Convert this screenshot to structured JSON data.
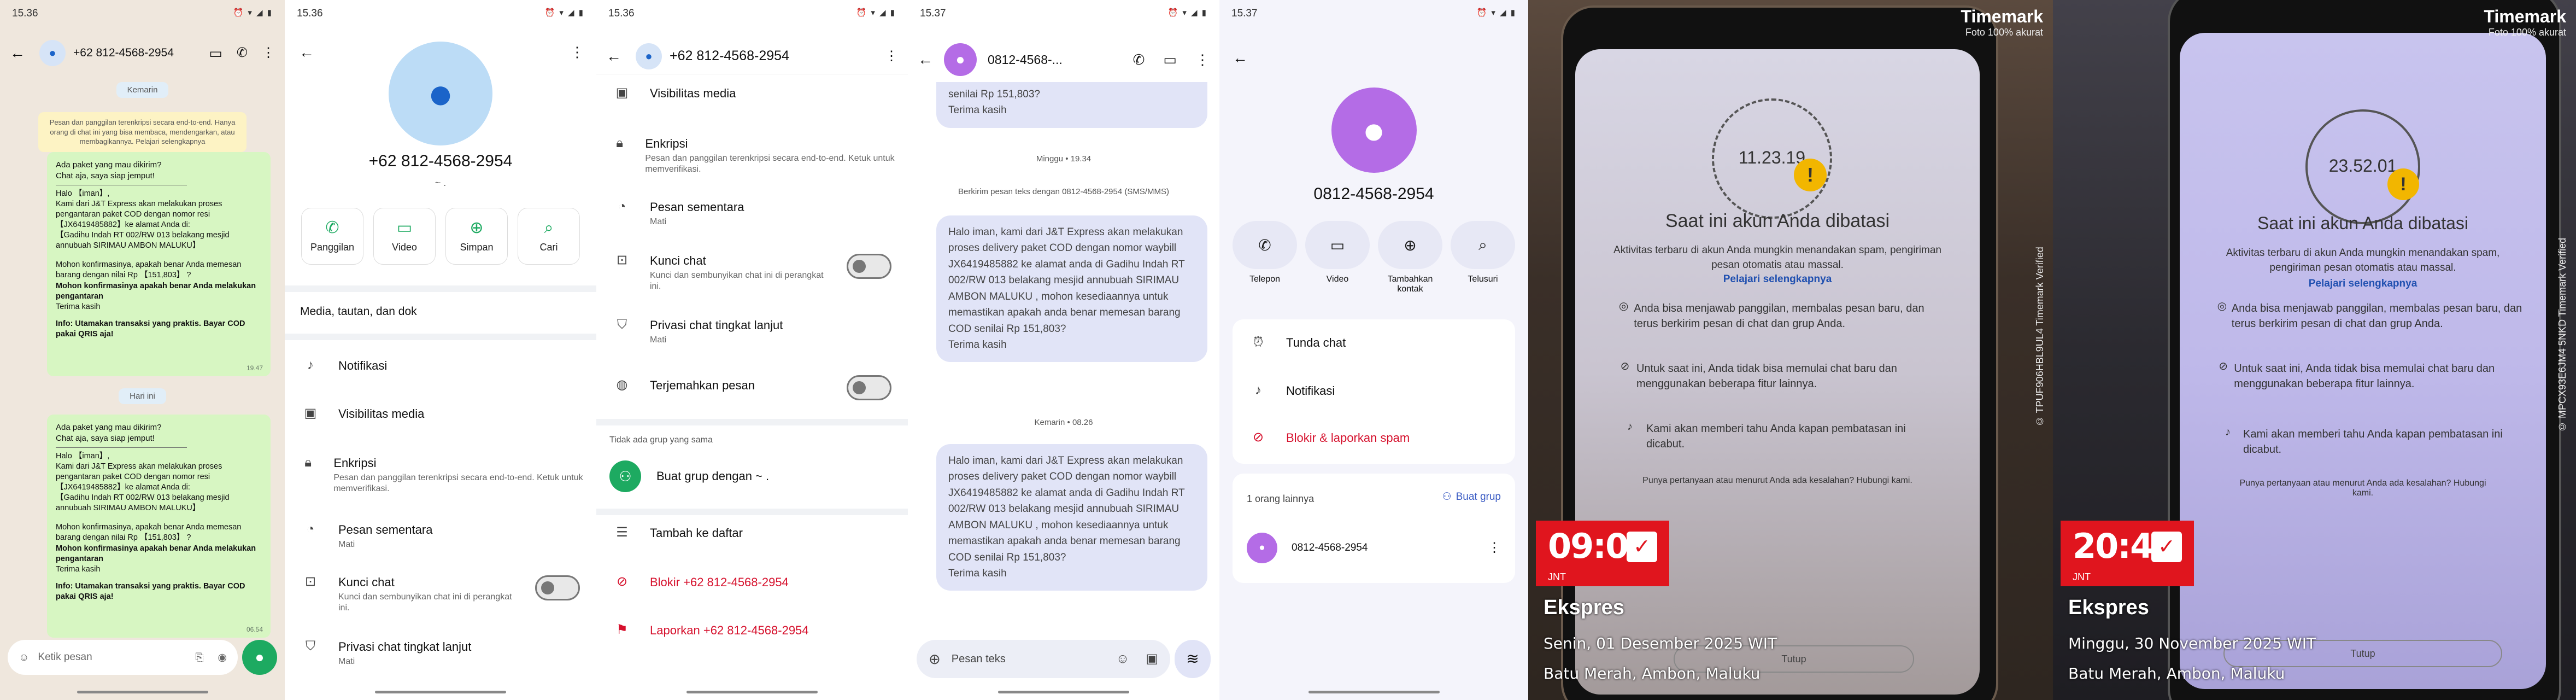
{
  "p1": {
    "time": "15.36",
    "title": "+62 812-4568-2954",
    "day1": "Kemarin",
    "day2": "Hari ini",
    "encryption": "Pesan dan panggilan terenkripsi secara end-to-end. Hanya orang di chat ini yang bisa membaca, mendengarkan, atau membagikannya. Pelajari selengkapnya",
    "m1_top": "Ada paket yang mau dikirim?\nChat aja, saya siap jemput!",
    "m1_body": "Halo 【iman】,\nKami dari J&T Express akan melakukan proses pengantaran paket COD dengan nomor resi 【JX6419485882】ke alamat Anda di:\n【Gadihu Indah RT 002/RW 013 belakang mesjid annubuah SIRIMAU AMBON MALUKU】",
    "m1_confirm": "Mohon konfirmasinya, apakah benar Anda memesan barang dengan nilai Rp 【151,803】 ?",
    "m1_bold": "Mohon konfirmasinya apakah benar Anda melakukan pengantaran",
    "m1_thanks": "Terima kasih",
    "m1_info": "Info: Utamakan transaksi yang praktis. Bayar COD pakai QRIS aja!",
    "m1_time": "19.47",
    "m2_time": "06.54",
    "compose": "Ketik pesan"
  },
  "p2": {
    "time": "15.36",
    "name": "+62 812-4568-2954",
    "about": "~ .",
    "actions": [
      "Panggilan",
      "Video",
      "Simpan",
      "Cari"
    ],
    "media": "Media, tautan, dan dok",
    "rows": [
      {
        "label": "Notifikasi"
      },
      {
        "label": "Visibilitas media"
      },
      {
        "label": "Enkripsi",
        "sub": "Pesan dan panggilan terenkripsi secara end-to-end. Ketuk untuk memverifikasi."
      },
      {
        "label": "Pesan sementara",
        "sub": "Mati"
      },
      {
        "label": "Kunci chat",
        "sub": "Kunci dan sembunyikan chat ini di perangkat ini."
      },
      {
        "label": "Privasi chat tingkat lanjut",
        "sub": "Mati"
      }
    ]
  },
  "p3": {
    "time": "15.36",
    "title": "+62 812-4568-2954",
    "rows": [
      {
        "label": "Visibilitas media"
      },
      {
        "label": "Enkripsi",
        "sub": "Pesan dan panggilan terenkripsi secara end-to-end. Ketuk untuk memverifikasi."
      },
      {
        "label": "Pesan sementara",
        "sub": "Mati"
      },
      {
        "label": "Kunci chat",
        "sub": "Kunci dan sembunyikan chat ini di perangkat ini."
      },
      {
        "label": "Privasi chat tingkat lanjut",
        "sub": "Mati"
      },
      {
        "label": "Terjemahkan pesan"
      }
    ],
    "nogroup": "Tidak ada grup yang sama",
    "create": "Buat grup dengan ~ .",
    "add": "Tambah ke daftar",
    "block": "Blokir +62 812-4568-2954",
    "report": "Laporkan +62 812-4568-2954"
  },
  "p4": {
    "time": "15.37",
    "title": "0812-4568-...",
    "top_tail": "senilai Rp 151,803?\nTerima kasih",
    "meta1": "Minggu • 19.34",
    "meta2": "Berkirim pesan teks dengan 0812-4568-2954 (SMS/MMS)",
    "meta3": "Kemarin • 08.26",
    "msg": "Halo iman, kami dari J&T Express akan melakukan proses delivery paket COD dengan nomor waybill JX6419485882 ke alamat anda di Gadihu Indah RT 002/RW 013 belakang mesjid annubuah  SIRIMAU AMBON MALUKU , mohon kesediaannya untuk memastikan apakah anda benar memesan barang COD senilai Rp 151,803?\nTerima kasih",
    "compose": "Pesan teks"
  },
  "p5": {
    "time": "15.37",
    "name": "0812-4568-2954",
    "actions": [
      "Telepon",
      "Video",
      "Tambahkan kontak",
      "Telusuri"
    ],
    "opts": [
      "Tunda chat",
      "Notifikasi",
      "Blokir & laporkan spam"
    ],
    "others": "1 orang lainnya",
    "makegroup": "Buat grup",
    "member": "0812-4568-2954"
  },
  "p6": {
    "brand": "Timemark",
    "verified": "Foto 100% akurat",
    "clock": "11.23.19",
    "heading": "Saat ini akun Anda dibatasi",
    "desc": "Aktivitas terbaru di akun Anda mungkin menandakan spam, pengiriman pesan otomatis atau massal.",
    "learn": "Pelajari selengkapnya",
    "items": [
      "Anda bisa menjawab panggilan, membalas pesan baru, dan terus berkirim pesan di chat dan grup Anda.",
      "Untuk saat ini, Anda tidak bisa memulai chat baru dan menggunakan beberapa fitur lainnya.",
      "Kami akan memberi tahu Anda kapan pembatasan ini dicabut."
    ],
    "question": "Punya pertanyaan atau menurut Anda ada kesalahan? Hubungi kami.",
    "close": "Tutup",
    "stamp_time": "09:09",
    "stamp_brand": "JNT",
    "label": "Ekspres",
    "date": "Senin, 01 Desember 2025 WIT",
    "place": "Batu Merah, Ambon, Maluku",
    "code": "© TPUF906HBL9UL4  Timemark Verified"
  },
  "p7": {
    "brand": "Timemark",
    "verified": "Foto 100% akurat",
    "clock": "23.52.01",
    "heading": "Saat ini akun Anda dibatasi",
    "desc": "Aktivitas terbaru di akun Anda mungkin menandakan spam, pengiriman pesan otomatis atau massal.",
    "learn": "Pelajari selengkapnya",
    "items": [
      "Anda bisa menjawab panggilan, membalas pesan baru, dan terus berkirim pesan di chat dan grup Anda.",
      "Untuk saat ini, Anda tidak bisa memulai chat baru dan menggunakan beberapa fitur lainnya.",
      "Kami akan memberi tahu Anda kapan pembatasan ini dicabut."
    ],
    "question": "Punya pertanyaan atau menurut Anda ada kesalahan? Hubungi kami.",
    "close": "Tutup",
    "stamp_time": "20:40",
    "stamp_brand": "JNT",
    "label": "Ekspres",
    "date": "Minggu, 30 November 2025 WIT",
    "place": "Batu Merah, Ambon, Maluku",
    "code": "© MPCX93E6JM4 5NKD  Timemark Verified"
  },
  "colors": {
    "wa_green": "#1daa61",
    "bubble_green": "#d7f6c2",
    "gmsg_bubble": "#e1e4f7",
    "gmsg_accent": "#b46ce6",
    "danger": "#d6112d",
    "stamp_red": "#e0151e"
  }
}
